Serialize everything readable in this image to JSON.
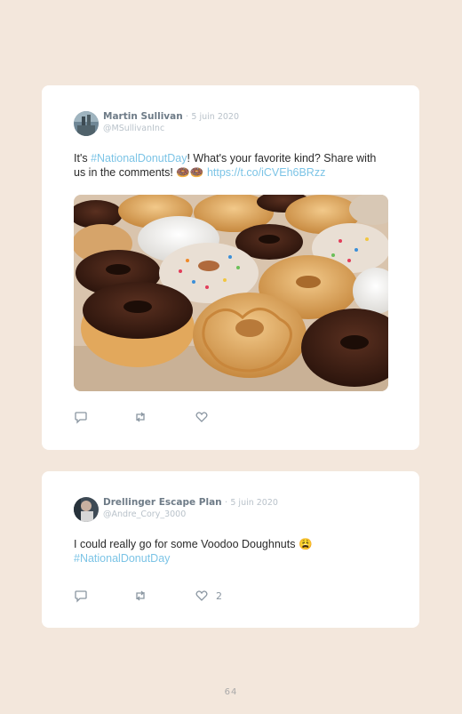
{
  "tweets": [
    {
      "author_name": "Martin Sullivan",
      "separator": "·",
      "date": "5 juin 2020",
      "handle": "@MSullivanInc",
      "text_before": "It's ",
      "hashtag": "#NationalDonutDay",
      "text_after": "! What's your favorite kind? Share with us in the comments! ",
      "emoji": "🍩🍩",
      "link": "https://t.co/iCVEh6BRzz",
      "image_description_icon": "donut-photo",
      "reply_icon": "reply-icon",
      "retweet_icon": "retweet-icon",
      "like_icon": "heart-icon",
      "like_count": ""
    },
    {
      "author_name": "Drellinger Escape Plan",
      "separator": "·",
      "date": "5 juin 2020",
      "handle": "@Andre_Cory_3000",
      "text_before": "I could really go for some Voodoo Doughnuts ",
      "emoji": "😩",
      "hashtag": "#NationalDonutDay",
      "reply_icon": "reply-icon",
      "retweet_icon": "retweet-icon",
      "like_icon": "heart-icon",
      "like_count": "2"
    }
  ],
  "page_number": "64",
  "colors": {
    "background": "#f3e7dc",
    "card": "#ffffff",
    "link": "#7cc4e6",
    "name": "#6e7b87",
    "muted": "#b9c2ca"
  }
}
